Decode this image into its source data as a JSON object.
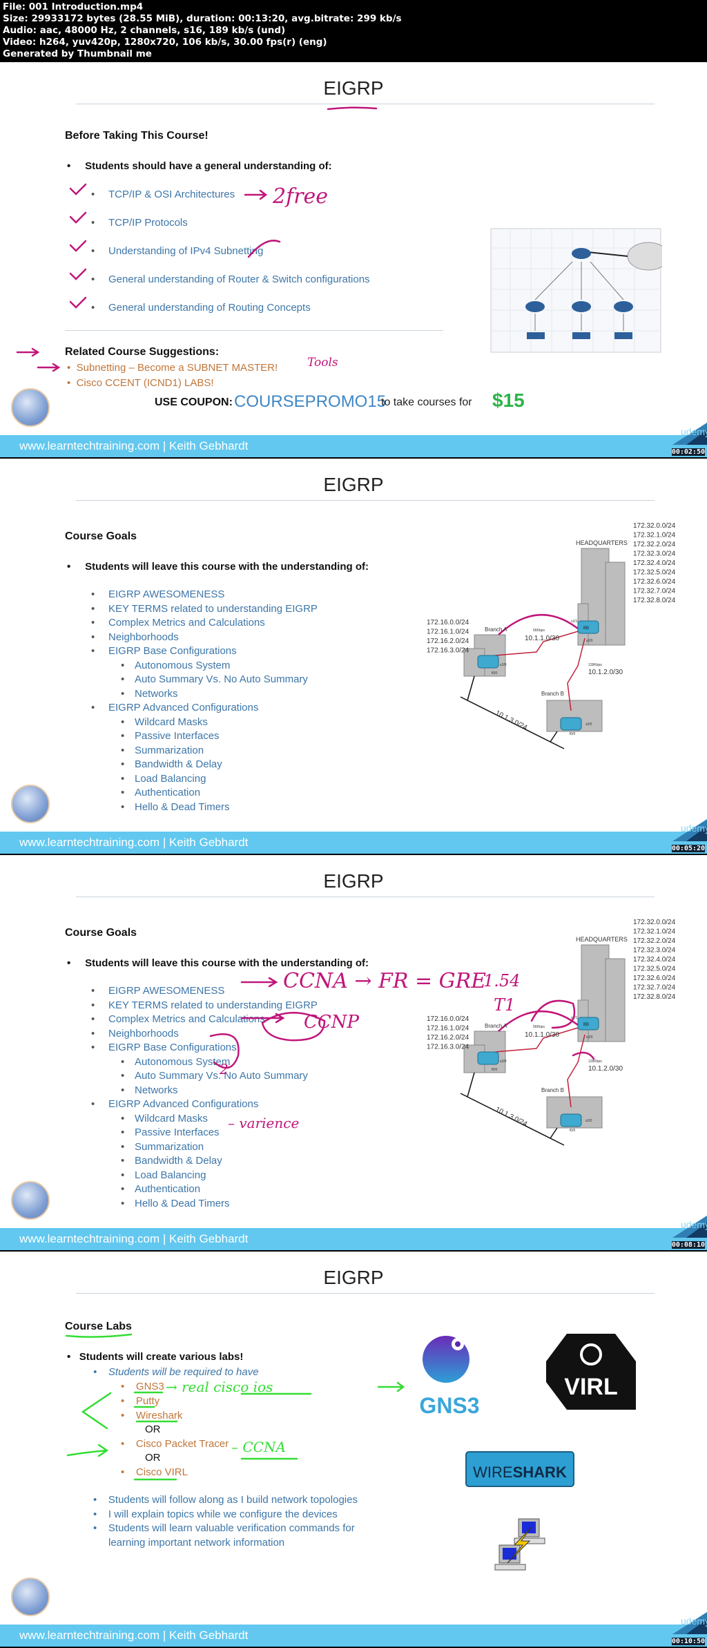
{
  "file_info": {
    "lines": [
      "File: 001 Introduction.mp4",
      "Size: 29933172 bytes (28.55 MiB), duration: 00:13:20, avg.bitrate: 299 kb/s",
      "Audio: aac, 48000 Hz, 2 channels, s16, 189 kb/s (und)",
      "Video: h264, yuv420p, 1280x720, 106 kb/s, 30.00 fps(r) (eng)",
      "Generated by Thumbnail me"
    ]
  },
  "slide_title": "EIGRP",
  "footer_text": "www.learntechtraining.com | Keith Gebhardt",
  "udemy": "udemy",
  "colors": {
    "footer": "#62c8ef",
    "item_blue": "#3d76a8",
    "orange": "#c0763a",
    "price_green": "#2fb34a",
    "ink_magenta": "#c0157a",
    "ink_green": "#33dd33"
  },
  "frame1": {
    "timestamp": "00:02:50",
    "heading": "Before Taking This Course!",
    "lead": "Students should have a general understanding of:",
    "items": [
      "TCP/IP & OSI Architectures",
      "TCP/IP Protocols",
      "Understanding of IPv4 Subnetting",
      "General understanding of Router & Switch configurations",
      "General understanding of Routing Concepts"
    ],
    "related_heading": "Related Course Suggestions:",
    "related": [
      "Subnetting – Become a SUBNET MASTER!",
      "Cisco CCENT (ICND1) LABS!"
    ],
    "coupon_label": "USE COUPON:",
    "coupon_code": "COURSEPROMO15",
    "coupon_text": "to take courses for",
    "price": "$15",
    "annotations": [
      "2free",
      "Tools"
    ]
  },
  "course_goals": {
    "heading": "Course Goals",
    "lead": "Students will leave this course with the understanding of:",
    "items": [
      {
        "t": "EIGRP AWESOMENESS",
        "l": 1
      },
      {
        "t": "KEY TERMS related to understanding EIGRP",
        "l": 1
      },
      {
        "t": "Complex Metrics and Calculations",
        "l": 1
      },
      {
        "t": "Neighborhoods",
        "l": 1
      },
      {
        "t": "EIGRP Base Configurations",
        "l": 1
      },
      {
        "t": "Autonomous System",
        "l": 2
      },
      {
        "t": "Auto Summary Vs. No Auto Summary",
        "l": 2
      },
      {
        "t": "Networks",
        "l": 2
      },
      {
        "t": "EIGRP Advanced Configurations",
        "l": 1
      },
      {
        "t": "Wildcard Masks",
        "l": 2
      },
      {
        "t": "Passive Interfaces",
        "l": 2
      },
      {
        "t": "Summarization",
        "l": 2
      },
      {
        "t": "Bandwidth & Delay",
        "l": 2
      },
      {
        "t": "Load Balancing",
        "l": 2
      },
      {
        "t": "Authentication",
        "l": 2
      },
      {
        "t": "Hello & Dead Timers",
        "l": 2
      }
    ]
  },
  "topology": {
    "hq_label": "HEADQUARTERS",
    "hq_nets": [
      "172.32.0.0/24",
      "172.32.1.0/24",
      "172.32.2.0/24",
      "172.32.3.0/24",
      "172.32.4.0/24",
      "172.32.5.0/24",
      "172.32.6.0/24",
      "172.32.7.0/24",
      "172.32.8.0/24"
    ],
    "branch_a": "Branch A",
    "branch_a_nets": [
      "172.16.0.0/24",
      "172.16.1.0/24",
      "172.16.2.0/24",
      "172.16.3.0/24"
    ],
    "branch_b": "Branch B",
    "link_a_speed": "56Kbps",
    "link_a_net": "10.1.1.0/30",
    "link_b_speed": "128Kbps",
    "link_b_net": "10.1.2.0/30",
    "lan_net": "10.1.3.0/24",
    "hq_router": "BB",
    "ifaces": {
      "hq_a": "s2/1",
      "hq_b": "s2/0",
      "a_serial": "s2/0",
      "a_lan": "f0/0",
      "b_serial": "s2/0",
      "b_lan": "f0/0"
    }
  },
  "frame2": {
    "timestamp": "00:05:20"
  },
  "frame3": {
    "timestamp": "00:08:10",
    "annotations": [
      "CCNA → FR = GRE",
      "CCNP",
      "1.54",
      "T1",
      "– varience",
      "2"
    ]
  },
  "frame4": {
    "timestamp": "00:10:50",
    "heading": "Course Labs",
    "lead": "Students will create various labs!",
    "required": "Students will be required to have",
    "tools": [
      "GNS3",
      "Putty",
      "Wireshark"
    ],
    "or": "OR",
    "tracer": "Cisco Packet Tracer",
    "virl": "Cisco VIRL",
    "bullets": [
      "Students will follow along as I build network topologies",
      "I will explain topics while we configure the devices",
      "Students will learn valuable verification commands for",
      "learning important network information"
    ],
    "logos": {
      "gns3": "GNS3",
      "virl": "VIRL",
      "wireshark_a": "WIRE",
      "wireshark_b": "SHARK"
    },
    "annotations": [
      "→ real cisco ios",
      "– CCNA"
    ]
  }
}
